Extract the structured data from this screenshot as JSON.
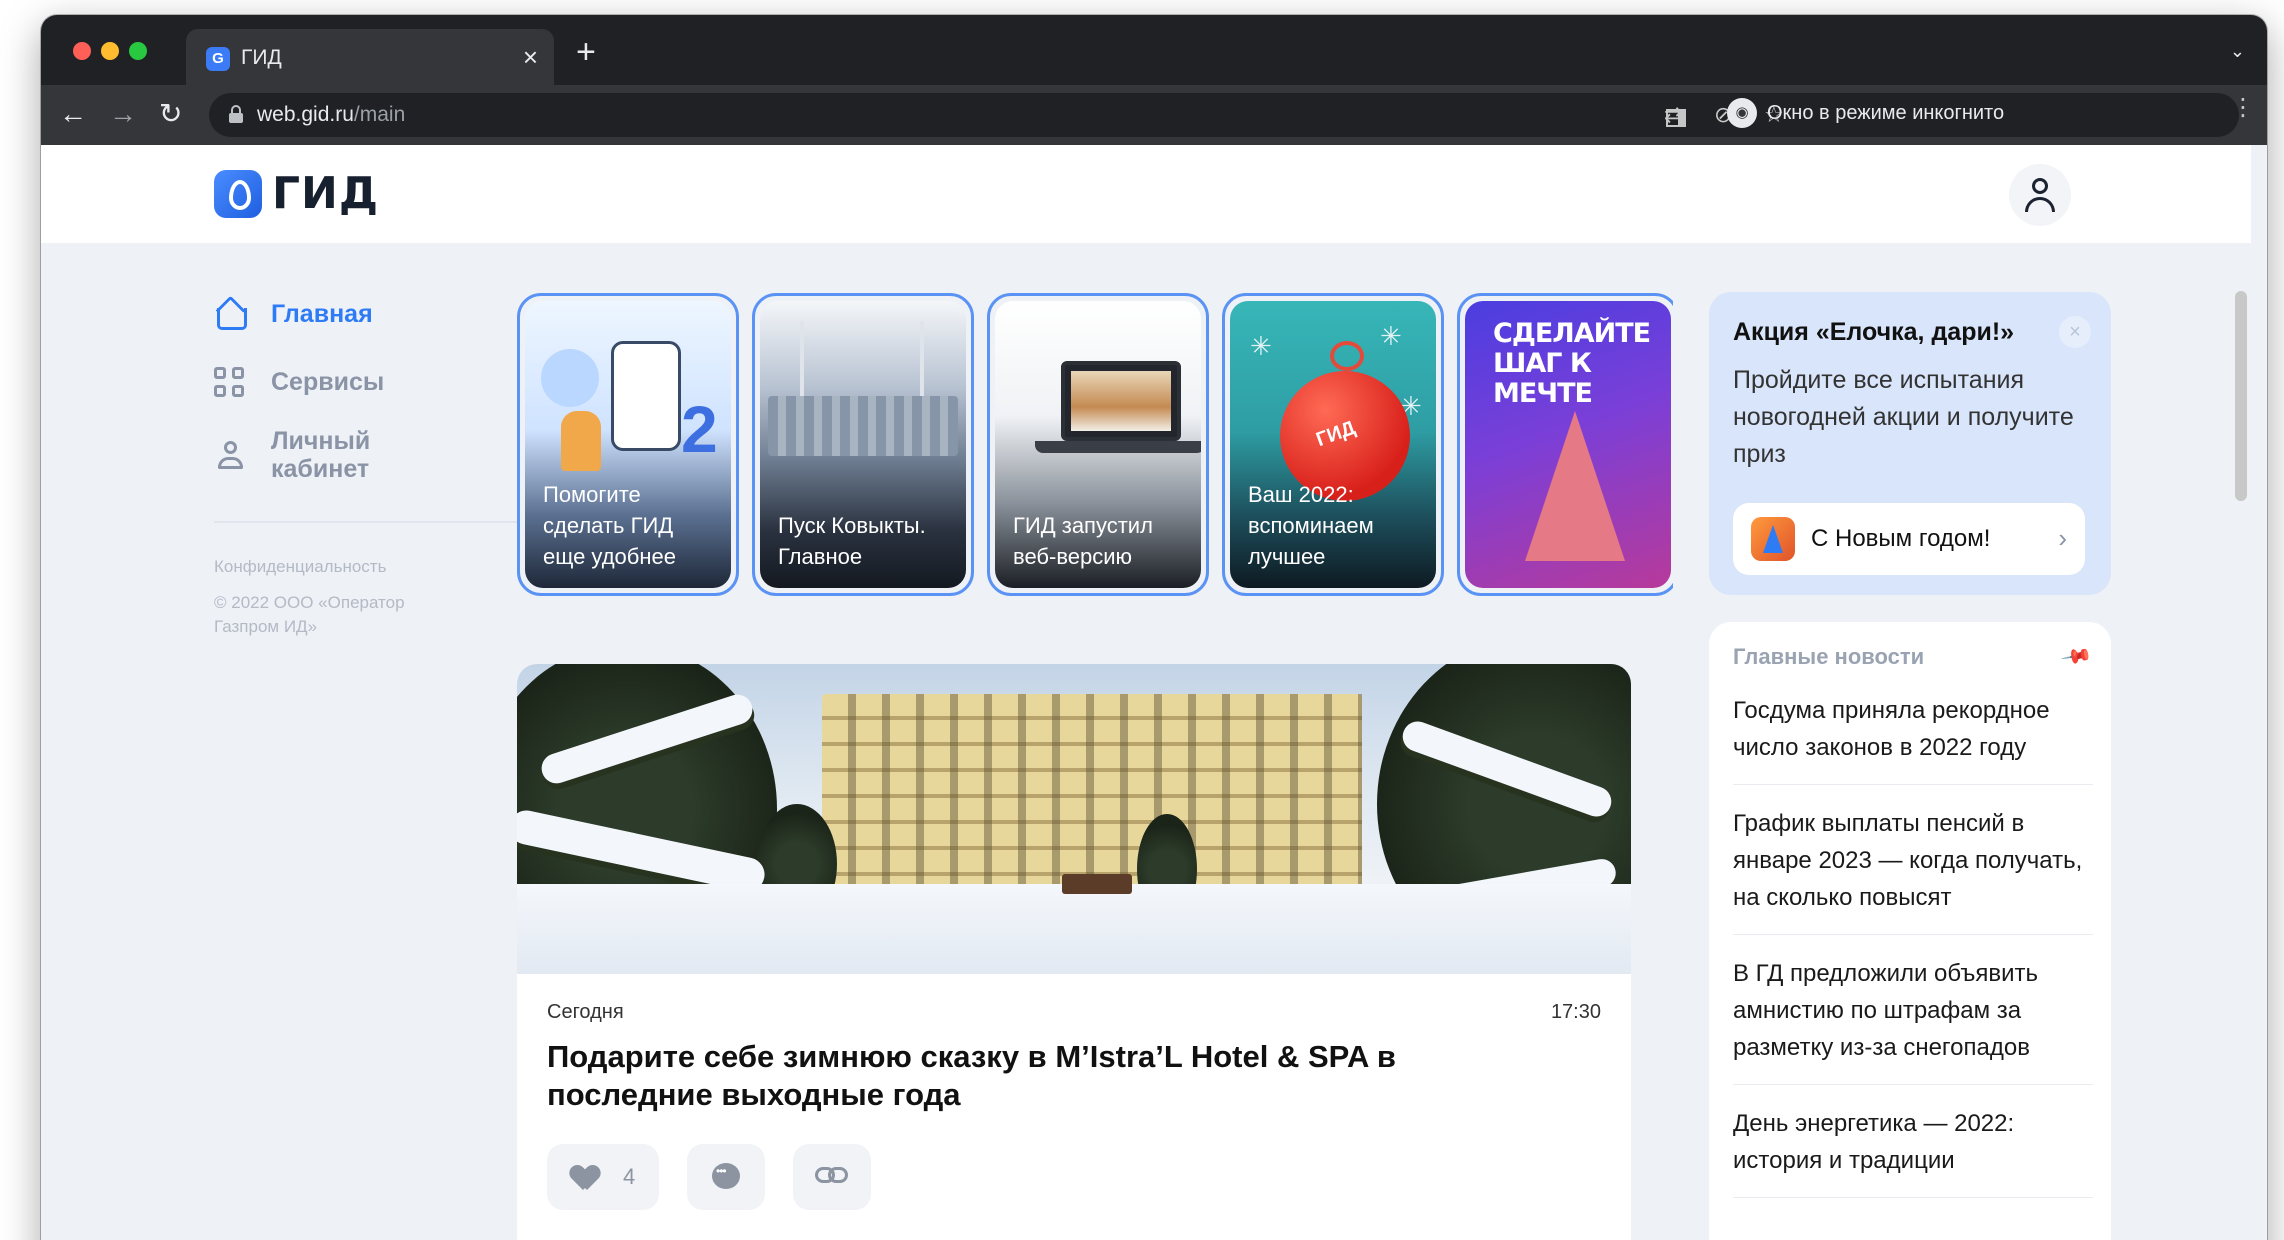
{
  "browser": {
    "tab_title": "ГИД",
    "tab_favicon": "gid-favicon",
    "close_symbol": "×",
    "new_tab_symbol": "+",
    "url_host": "web.gid.ru",
    "url_path": "/main",
    "incognito_label": "Окно в режиме инкогнито",
    "icons": [
      "back-icon",
      "forward-icon",
      "reload-icon",
      "lock-icon",
      "translate-icon",
      "eye-off-icon",
      "star-icon",
      "side-panel-icon",
      "incognito-icon",
      "menu-icon"
    ]
  },
  "header": {
    "logo_text": "ГИД",
    "profile_icon": "user-icon"
  },
  "sidebar": {
    "items": [
      {
        "label": "Главная",
        "icon": "home-icon",
        "active": true
      },
      {
        "label": "Сервисы",
        "icon": "grid-icon",
        "active": false
      },
      {
        "label": "Личный кабинет",
        "icon": "person-icon",
        "active": false
      }
    ],
    "privacy": "Конфиденциальность",
    "copyright": "© 2022 ООО «Оператор Газпром ИД»"
  },
  "stories": [
    {
      "caption": "Помогите сделать ГИД еще удобнее"
    },
    {
      "caption": "Пуск Ковыкты. Главное"
    },
    {
      "caption": "ГИД запустил веб-версию"
    },
    {
      "caption": "Ваш 2022: вспоминаем лучшее",
      "badge": "ГИД"
    },
    {
      "caption": "",
      "headline": "СДЕЛАЙТЕ ШАГ К МЕЧТЕ"
    }
  ],
  "feature": {
    "date": "Сегодня",
    "time": "17:30",
    "title": "Подарите себе зимнюю сказку в M’Istra’L Hotel & SPA в последние выходные года",
    "likes": "4"
  },
  "promo": {
    "title": "Акция «Елочка, дари!»",
    "text": "Пройдите все испытания новогодней акции и получите приз",
    "button_label": "С Новым годом!",
    "close_symbol": "×",
    "chevron": "›"
  },
  "news": {
    "heading": "Главные новости",
    "items": [
      "Госдума приняла рекордное число законов в 2022 году",
      "График выплаты пенсий в январе 2023 — когда получать, на сколько повысят",
      "В ГД предложили объявить амнистию по штрафам за разметку из-за снегопадов",
      "День энергетика — 2022: история и традиции"
    ]
  }
}
